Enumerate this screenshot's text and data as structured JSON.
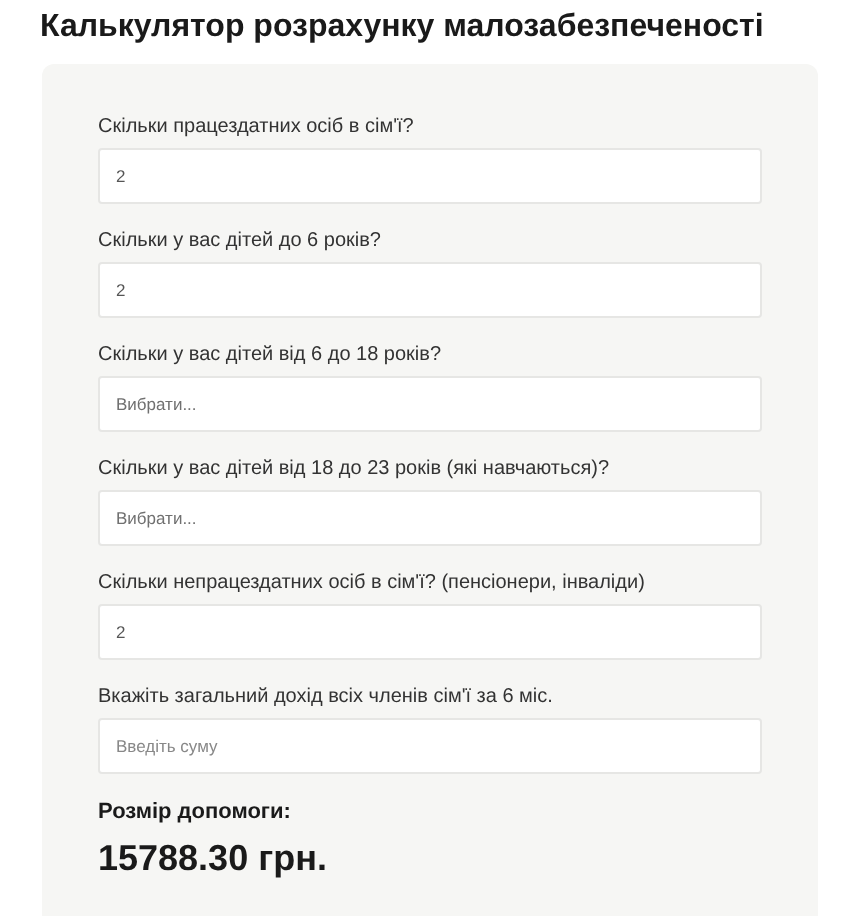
{
  "title": "Калькулятор розрахунку малозабезпеченості",
  "fields": [
    {
      "label": "Скільки працездатних осіб в сім'ї?",
      "kind": "text",
      "value": "2"
    },
    {
      "label": "Скільки у вас дітей до 6 років?",
      "kind": "text",
      "value": "2"
    },
    {
      "label": "Скільки у вас дітей від 6 до 18 років?",
      "kind": "select",
      "placeholder": "Вибрати..."
    },
    {
      "label": "Скільки у вас дітей від 18 до 23 років (які навчаються)?",
      "kind": "select",
      "placeholder": "Вибрати..."
    },
    {
      "label": "Скільки непрацездатних осіб в сім'ї? (пенсіонери, інваліди)",
      "kind": "text",
      "value": "2"
    },
    {
      "label": "Вкажіть загальний дохід всіх членів сім'ї за 6 міс.",
      "kind": "text",
      "placeholder": "Введіть суму"
    }
  ],
  "result": {
    "label": "Розмір допомоги:",
    "amount": "15788.30 грн."
  }
}
